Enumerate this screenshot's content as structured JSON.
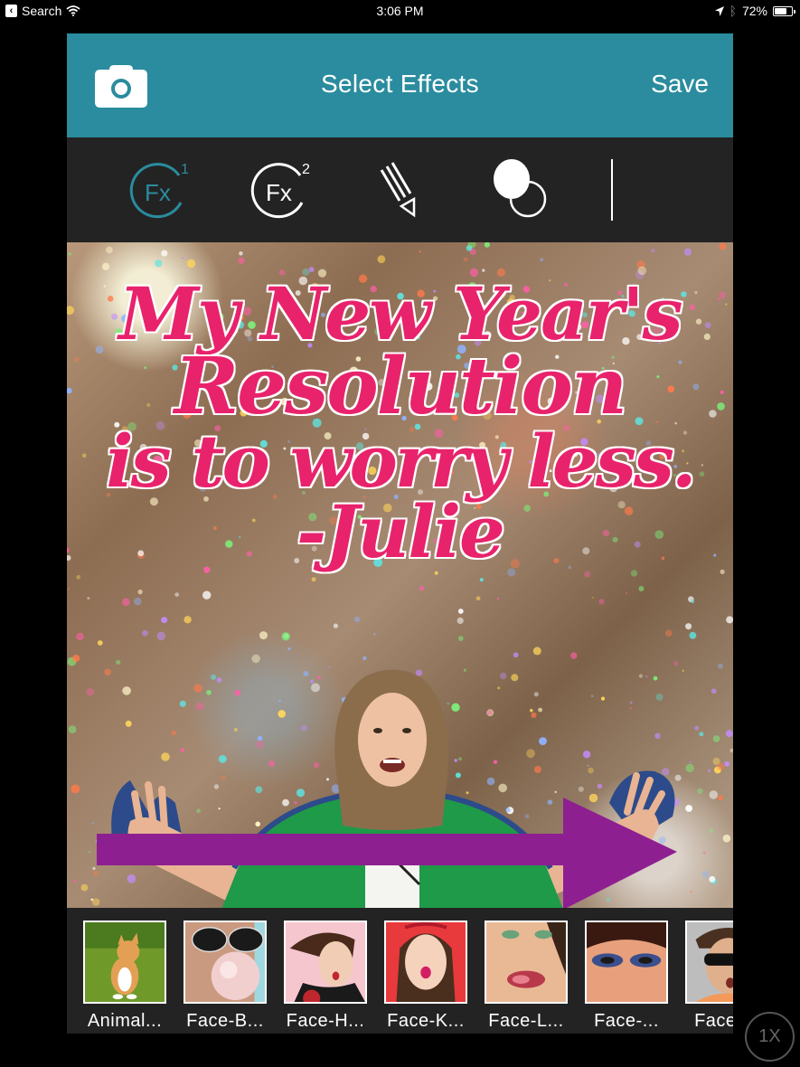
{
  "status_bar": {
    "back_app": "Search",
    "time": "3:06 PM",
    "battery_percent": "72%",
    "battery_level": 0.72,
    "icons": [
      "back-chevron-icon",
      "wifi-icon",
      "location-arrow-icon",
      "bluetooth-icon",
      "battery-icon"
    ]
  },
  "navbar": {
    "camera_icon": "camera-icon",
    "title": "Select Effects",
    "save_label": "Save",
    "background_color": "#2a8c9e"
  },
  "toolbar": {
    "tools": [
      {
        "name": "fx1",
        "label": "Fx",
        "superscript": "1",
        "active": true,
        "icon": "fx-1-icon"
      },
      {
        "name": "fx2",
        "label": "Fx",
        "superscript": "2",
        "active": false,
        "icon": "fx-2-icon"
      },
      {
        "name": "draw",
        "label": "",
        "active": false,
        "icon": "pencil-icon"
      },
      {
        "name": "blend",
        "label": "",
        "active": false,
        "icon": "blend-circles-icon"
      }
    ],
    "active_color": "#2a8c9e"
  },
  "canvas": {
    "quote_lines": [
      "My New Year's",
      "Resolution",
      "is to worry less.",
      "-Julie"
    ],
    "quote_color": "#e8236b",
    "arrow_color": "#8e1f91",
    "background": "glitter"
  },
  "effects": [
    {
      "label": "Animal...",
      "thumb": "kitten"
    },
    {
      "label": "Face-B...",
      "thumb": "bubblegum-sunglasses"
    },
    {
      "label": "Face-H...",
      "thumb": "hair-surprised"
    },
    {
      "label": "Face-K...",
      "thumb": "kiss"
    },
    {
      "label": "Face-L...",
      "thumb": "lips"
    },
    {
      "label": "Face-...",
      "thumb": "eyeshadow"
    },
    {
      "label": "Face-...",
      "thumb": "sunglasses-man"
    }
  ],
  "zoom_badge": "1X"
}
